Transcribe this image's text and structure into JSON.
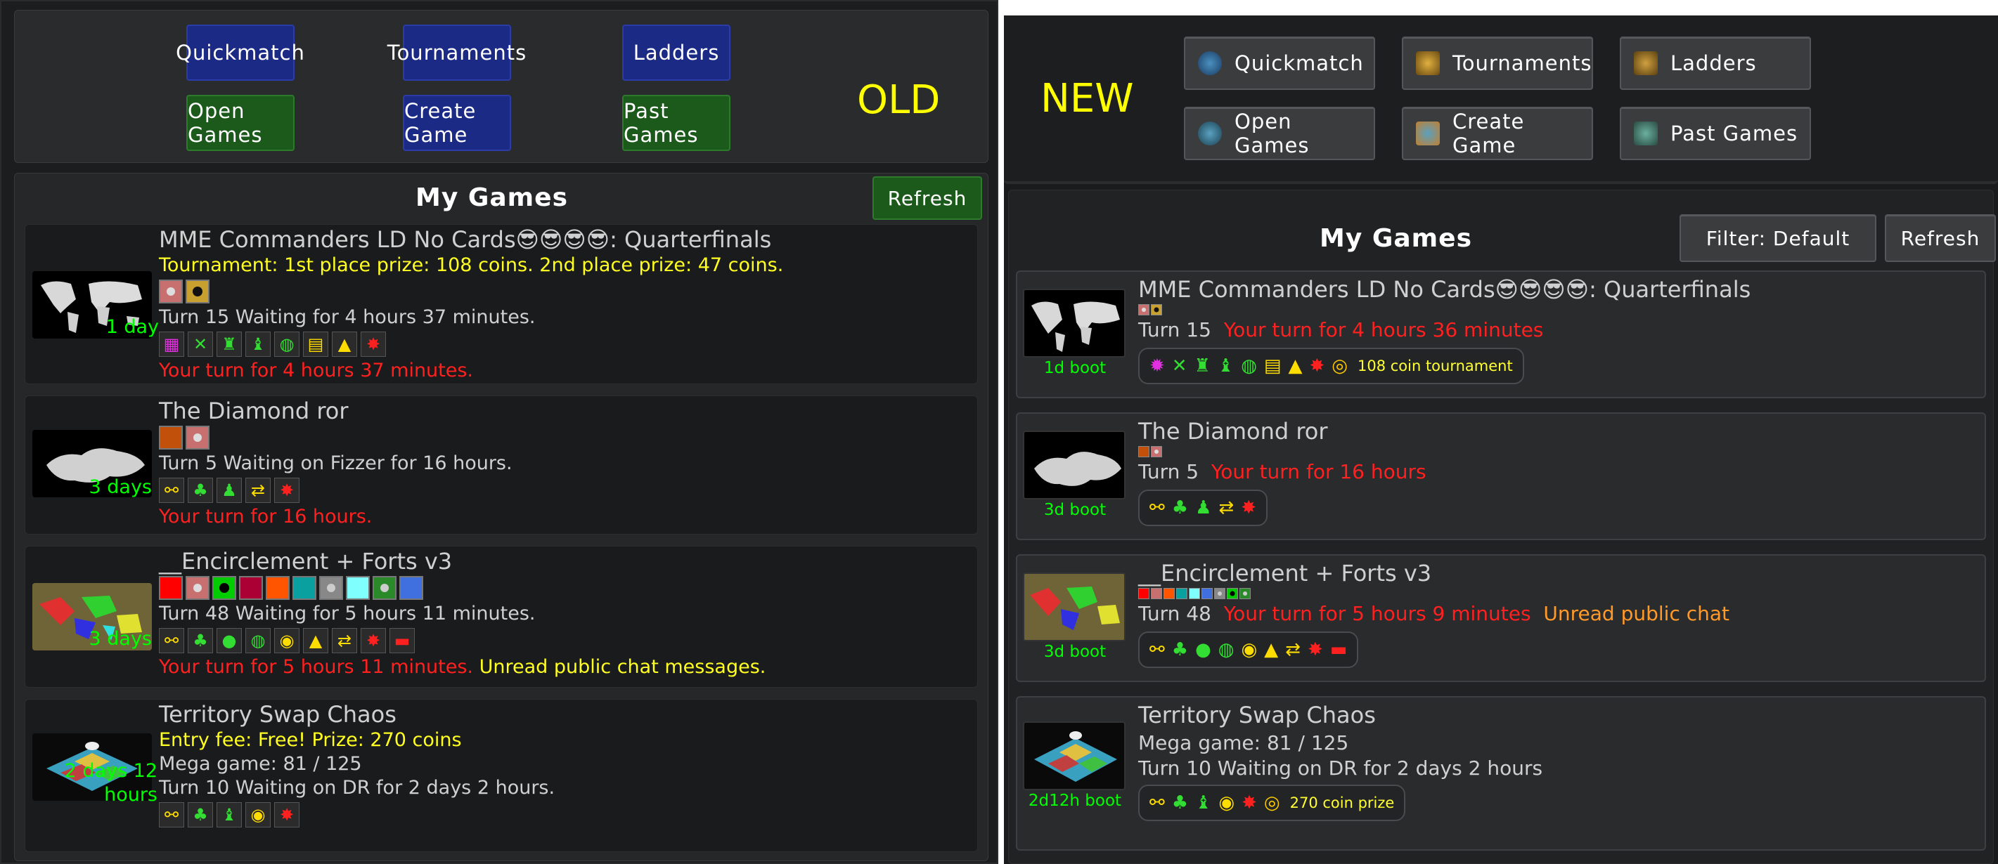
{
  "colors": {
    "accent_yellow": "#ffff22",
    "turn_red": "#ff2020",
    "chat_orange": "#ff9a2a",
    "timer_green": "#00ff00"
  },
  "old": {
    "tag": "OLD",
    "buttons": {
      "quickmatch": "Quickmatch",
      "tournaments": "Tournaments",
      "ladders": "Ladders",
      "open_games": "Open Games",
      "create_game": "Create Game",
      "past_games": "Past Games"
    },
    "title": "My Games",
    "refresh": "Refresh",
    "games": [
      {
        "name": "MME Commanders LD No Cards😎😎😎😎: Quarterfinals",
        "info": "Tournament: 1st place prize: 108 coins.  2nd place prize: 47 coins.",
        "turn": "Turn 15   Waiting for 4 hours 37 minutes.",
        "status": "Your turn for 4 hours 37 minutes.",
        "timer": "1 day"
      },
      {
        "name": "The Diamond ror",
        "turn": "Turn 5   Waiting on Fizzer for 16 hours.",
        "status": "Your turn for 16 hours.",
        "timer": "3 days"
      },
      {
        "name": "__Encirclement + Forts v3",
        "turn": "Turn 48   Waiting for 5 hours 11 minutes.",
        "status": "Your turn for 5 hours 11 minutes.",
        "chat": "Unread public chat messages.",
        "timer": "3 days"
      },
      {
        "name": "Territory Swap Chaos",
        "info": "Entry fee: Free!  Prize: 270 coins",
        "mega": "Mega game: 81 / 125",
        "turn": "Turn 10   Waiting on DR for 2 days 2 hours.",
        "timer_a": "2 days 12",
        "timer_b": "hours"
      }
    ]
  },
  "new": {
    "tag": "NEW",
    "buttons": {
      "quickmatch": "Quickmatch",
      "tournaments": "Tournaments",
      "ladders": "Ladders",
      "open_games": "Open Games",
      "create_game": "Create Game",
      "past_games": "Past Games"
    },
    "title": "My Games",
    "filter": "Filter: Default",
    "refresh": "Refresh",
    "games": [
      {
        "name": "MME Commanders LD No Cards😎😎😎😎: Quarterfinals",
        "turn": "Turn 15",
        "status": "Your turn for 4 hours 36 minutes",
        "boot": "1d boot",
        "pill_text": "108 coin tournament"
      },
      {
        "name": "The Diamond ror",
        "turn": "Turn 5",
        "status": "Your turn for 16 hours",
        "boot": "3d boot"
      },
      {
        "name": "__Encirclement + Forts v3",
        "turn": "Turn 48",
        "status": "Your turn for 5 hours 9 minutes",
        "chat": "Unread public chat",
        "boot": "3d boot"
      },
      {
        "name": "Territory Swap Chaos",
        "mega": "Mega game: 81 / 125",
        "turn": "Turn 10  Waiting on DR for 2 days 2 hours",
        "boot": "2d12h boot",
        "pill_text": "270 coin prize"
      }
    ]
  }
}
